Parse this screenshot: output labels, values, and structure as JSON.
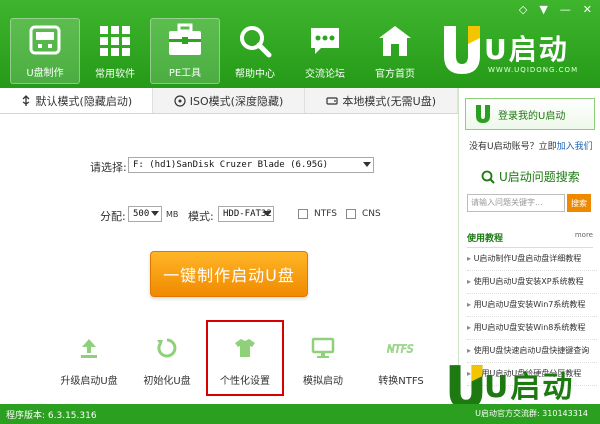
{
  "window": {
    "ctl_skin": "◇",
    "ctl_menu": "▼",
    "ctl_min": "—",
    "ctl_close": "✕"
  },
  "nav": [
    {
      "label": "U盘制作",
      "icon": "usb-drive-icon",
      "active": true
    },
    {
      "label": "常用软件",
      "icon": "grid-apps-icon",
      "active": false
    },
    {
      "label": "PE工具",
      "icon": "toolbox-icon",
      "active": true
    },
    {
      "label": "帮助中心",
      "icon": "magnifier-icon",
      "active": false
    },
    {
      "label": "交流论坛",
      "icon": "chat-bubble-icon",
      "active": false
    },
    {
      "label": "官方首页",
      "icon": "home-icon",
      "active": false
    }
  ],
  "brand": {
    "text": "U启动",
    "sub": "WWW.UQIDONG.COM"
  },
  "tabs": [
    {
      "label": "默认模式(隐藏启动)",
      "active": true
    },
    {
      "label": "ISO模式(深度隐藏)",
      "active": false
    },
    {
      "label": "本地模式(无需U盘)",
      "active": false
    }
  ],
  "form": {
    "select_label": "请选择:",
    "device_value": "F: (hd1)SanDisk Cruzer Blade (6.95G)",
    "alloc_label": "分配:",
    "alloc_value": "500",
    "alloc_unit": "MB",
    "mode_label": "模式:",
    "mode_value": "HDD-FAT32",
    "ntfs_label": "NTFS",
    "cns_label": "CNS"
  },
  "make_button": "一键制作启动U盘",
  "tools": [
    {
      "label": "升级启动U盘",
      "icon": "upgrade-icon"
    },
    {
      "label": "初始化U盘",
      "icon": "refresh-icon"
    },
    {
      "label": "个性化设置",
      "icon": "tshirt-icon"
    },
    {
      "label": "模拟启动",
      "icon": "monitor-icon"
    },
    {
      "label": "转换NTFS",
      "icon": "ntfs-icon"
    }
  ],
  "sidebar": {
    "login_label": "登录我的U启动",
    "no_account": "没有U启动账号？立即",
    "join_link": "加入我们",
    "search_title": "U启动问题搜索",
    "search_placeholder": "请输入问题关键字...",
    "search_button": "搜索",
    "tutorial_title": "使用教程",
    "more_label": "more",
    "tutorials": [
      "U启动制作U盘启动盘详细教程",
      "使用U启动U盘安装XP系统教程",
      "用U启动U盘安装Win7系统教程",
      "用U启动U盘安装Win8系统教程",
      "使用U盘快速启动U盘快捷键查询",
      "使用U启动U盘给硬盘分区教程"
    ]
  },
  "watermark": {
    "text": "U启动"
  },
  "status": {
    "version": "程序版本: 6.3.15.316",
    "qq": "U启动官方交流群: 310143314"
  },
  "colors": {
    "green": "#2b9f1f",
    "orange": "#f08a00",
    "red_outline": "#d60000"
  }
}
